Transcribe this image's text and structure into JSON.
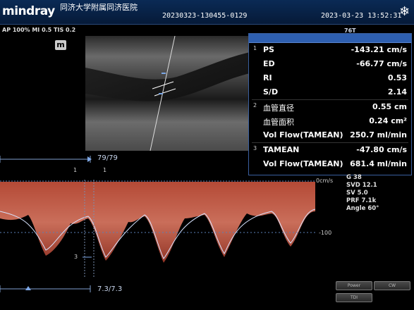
{
  "header": {
    "brand": "mindray",
    "hospital": "同济大学附属同济医院",
    "patient_id": "20230323-130455-0129",
    "datetime": "2023-03-23  13:52:31"
  },
  "params_line": "AP 100%  MI 0.5  TIS 0.2",
  "m_logo": "m",
  "tab_label": "76T",
  "measurements": [
    {
      "idx": "1",
      "label": "PS",
      "value": "-143.21 cm/s"
    },
    {
      "idx": "",
      "label": "ED",
      "value": "-66.77 cm/s"
    },
    {
      "idx": "",
      "label": "RI",
      "value": "0.53"
    },
    {
      "idx": "",
      "label": "S/D",
      "value": "2.14"
    },
    {
      "idx": "2",
      "label": "血管直径",
      "value": "0.55 cm"
    },
    {
      "idx": "",
      "label": "血管面积",
      "value": "0.24 cm²"
    },
    {
      "idx": "",
      "label": "Vol Flow(TAMEAN)",
      "value": "250.7 ml/min"
    },
    {
      "idx": "3",
      "label": "TAMEAN",
      "value": "-47.80 cm/s"
    },
    {
      "idx": "",
      "label": "Vol Flow(TAMEAN)",
      "value": "681.4 ml/min"
    }
  ],
  "doppler": {
    "depth_label": "79/79",
    "bottom_label": "7.3/7.3",
    "scale_top": "0cm/s",
    "scale_mid": "-100",
    "marker_1a": "1",
    "marker_1b": "1",
    "marker_3": "3",
    "params": [
      "G 38",
      "SVD 12.1",
      "SV 5.0",
      "PRF 7.1k",
      "Angle 60°"
    ]
  },
  "buttons": {
    "power": "Power",
    "cw": "CW",
    "tdi": "TDI"
  }
}
